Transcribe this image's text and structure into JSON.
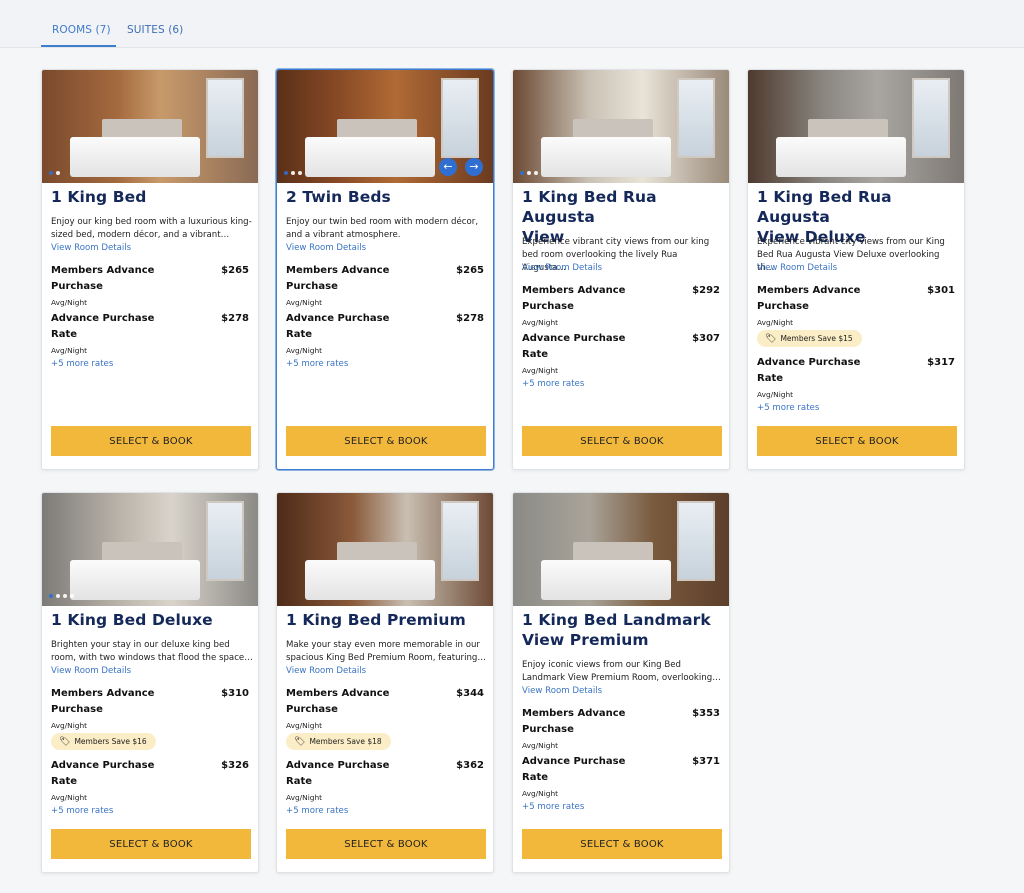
{
  "tabs": [
    {
      "label": "ROOMS (7)",
      "active": true
    },
    {
      "label": "SUITES (6)",
      "active": false
    }
  ],
  "button_label": "SELECT & BOOK",
  "details_label": "View Room Details",
  "more_rates_label": "+5 more rates",
  "avg_label": "Avg/Night",
  "colors": {
    "accent": "#3e7bcc",
    "title": "#14285a",
    "button": "#f2b83c",
    "badge": "#fbedc6"
  },
  "rooms": [
    {
      "title_l1": "1 King Bed",
      "title_l2": "",
      "desc_l1": "Enjoy our king bed room with a luxurious king-",
      "desc_l2": "sized bed, modern décor, and a vibrant…",
      "rate1_l1": "Members Advance",
      "rate1_l2": "Purchase",
      "rate1_price": "$265",
      "badge": "",
      "rate2_l1": "Advance Purchase",
      "rate2_l2": "Rate",
      "rate2_price": "$278",
      "photo_dots": 2
    },
    {
      "title_l1": "2 Twin Beds",
      "title_l2": "",
      "desc_l1": "Enjoy our twin bed room with modern décor,",
      "desc_l2": "and a vibrant atmosphere.",
      "rate1_l1": "Members Advance",
      "rate1_l2": "Purchase",
      "rate1_price": "$265",
      "badge": "",
      "rate2_l1": "Advance Purchase",
      "rate2_l2": "Rate",
      "rate2_price": "$278",
      "photo_dots": 3
    },
    {
      "title_l1": "1 King Bed Rua Augusta",
      "title_l2": "View",
      "desc_l1": "Experience vibrant city views from our king",
      "desc_l2": "bed room overlooking the lively Rua Augusta…",
      "rate1_l1": "Members Advance",
      "rate1_l2": "Purchase",
      "rate1_price": "$292",
      "badge": "",
      "rate2_l1": "Advance Purchase",
      "rate2_l2": "Rate",
      "rate2_price": "$307",
      "photo_dots": 3
    },
    {
      "title_l1": "1 King Bed Rua Augusta",
      "title_l2": "View Deluxe",
      "desc_l1": "Experience vibrant city views from our King",
      "desc_l2": "Bed Rua Augusta View Deluxe overlooking th…",
      "rate1_l1": "Members Advance",
      "rate1_l2": "Purchase",
      "rate1_price": "$301",
      "badge": "Members Save $15",
      "rate2_l1": "Advance Purchase",
      "rate2_l2": "Rate",
      "rate2_price": "$317",
      "photo_dots": 0
    },
    {
      "title_l1": "1 King Bed Deluxe",
      "title_l2": "",
      "desc_l1": "Brighten your stay in our deluxe king bed",
      "desc_l2": "room, with two windows that flood the space…",
      "rate1_l1": "Members Advance",
      "rate1_l2": "Purchase",
      "rate1_price": "$310",
      "badge": "Members Save $16",
      "rate2_l1": "Advance Purchase",
      "rate2_l2": "Rate",
      "rate2_price": "$326",
      "photo_dots": 4
    },
    {
      "title_l1": "1 King Bed Premium",
      "title_l2": "",
      "desc_l1": "Make your stay even more memorable in our",
      "desc_l2": "spacious King Bed Premium Room, featuring…",
      "rate1_l1": "Members Advance",
      "rate1_l2": "Purchase",
      "rate1_price": "$344",
      "badge": "Members Save $18",
      "rate2_l1": "Advance Purchase",
      "rate2_l2": "Rate",
      "rate2_price": "$362",
      "photo_dots": 0
    },
    {
      "title_l1": "1 King Bed Landmark",
      "title_l2": "View Premium",
      "desc_l1": "Enjoy iconic views from our King Bed",
      "desc_l2": "Landmark View Premium Room, overlooking…",
      "rate1_l1": "Members Advance",
      "rate1_l2": "Purchase",
      "rate1_price": "$353",
      "badge": "",
      "rate2_l1": "Advance Purchase",
      "rate2_l2": "Rate",
      "rate2_price": "$371",
      "photo_dots": 0
    }
  ]
}
